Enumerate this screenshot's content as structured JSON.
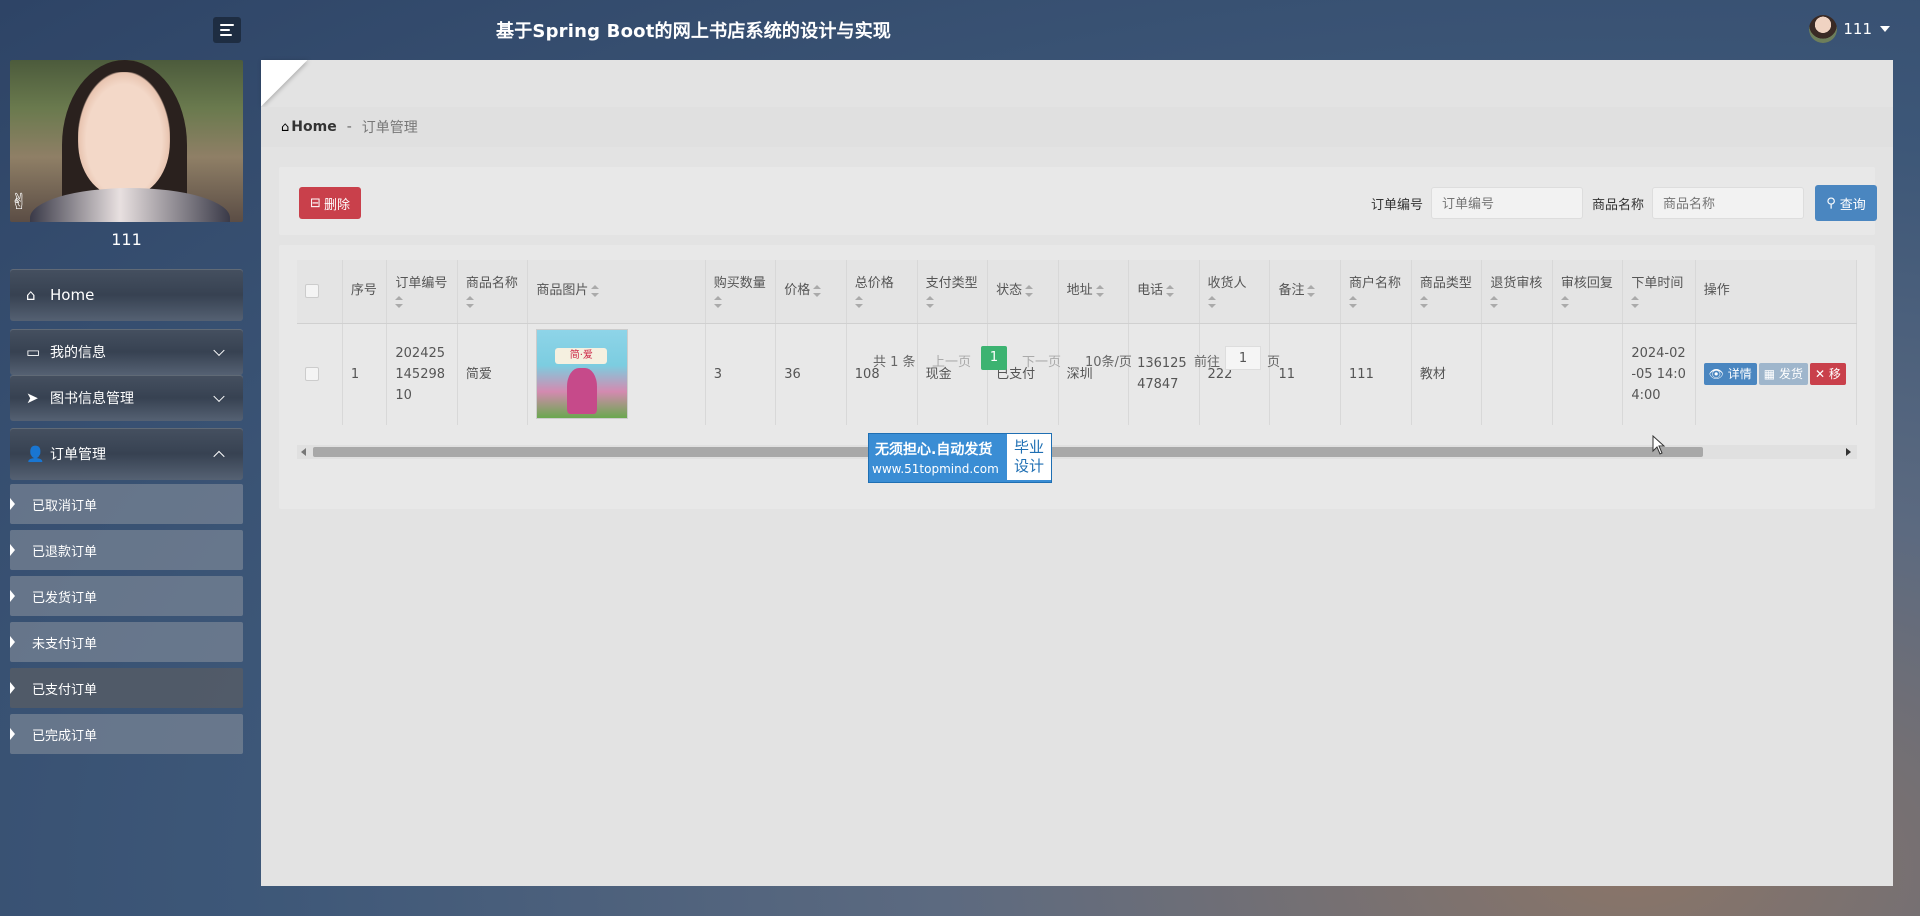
{
  "header": {
    "title": "基于Spring Boot的网上书店系统的设计与实现",
    "username": "111"
  },
  "sidebar": {
    "profile_name": "111",
    "items": [
      {
        "label": "Home"
      },
      {
        "label": "我的信息"
      },
      {
        "label": "图书信息管理"
      },
      {
        "label": "订单管理"
      }
    ],
    "sub_items": [
      "已取消订单",
      "已退款订单",
      "已发货订单",
      "未支付订单",
      "已支付订单",
      "已完成订单"
    ]
  },
  "breadcrumb": {
    "home": "Home",
    "separator": "-",
    "current": "订单管理"
  },
  "toolbar": {
    "delete_label": "删除",
    "order_no_label": "订单编号",
    "order_no_placeholder": "订单编号",
    "product_label": "商品名称",
    "product_placeholder": "商品名称",
    "query_label": "查询"
  },
  "table": {
    "headers": [
      "序号",
      "订单编号",
      "商品名称",
      "商品图片",
      "购买数量",
      "价格",
      "总价格",
      "支付类型",
      "状态",
      "地址",
      "电话",
      "收货人",
      "备注",
      "商户名称",
      "商品类型",
      "退货审核",
      "审核回复",
      "下单时间",
      "操作"
    ],
    "row": {
      "index": "1",
      "order_no": "20242514529810",
      "product_name": "简爱",
      "book_cover_text": "简·爱",
      "quantity": "3",
      "price": "36",
      "total": "108",
      "pay_type": "现金",
      "status": "已支付",
      "address": "深圳",
      "phone": "13612547847",
      "receiver": "222",
      "remark": "11",
      "merchant": "111",
      "category": "教材",
      "return_review": "",
      "review_reply": "",
      "order_time": "2024-02-05 14:04:00",
      "op_view": "详情",
      "op_ship": "发货",
      "op_remove": "移"
    }
  },
  "pagination": {
    "total_text": "共 1 条",
    "prev": "上一页",
    "current": "1",
    "next": "下一页",
    "page_size": "10条/页",
    "goto_prefix": "前往",
    "goto_value": "1",
    "goto_suffix": "页"
  },
  "promo": {
    "line1": "无须担心.自动发货",
    "line2": "www.51topmind.com",
    "badge": "毕业设计"
  },
  "colors": {
    "danger": "#c9404b",
    "primary": "#4a86c0",
    "success": "#3cb371"
  }
}
